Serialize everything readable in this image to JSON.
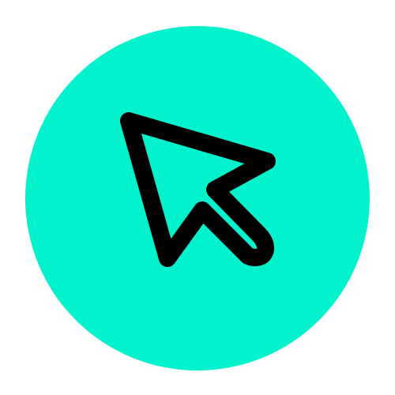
{
  "icon": {
    "name": "cursor-arrow-icon",
    "background_color": "#02F2CE",
    "stroke_color": "#000000"
  }
}
